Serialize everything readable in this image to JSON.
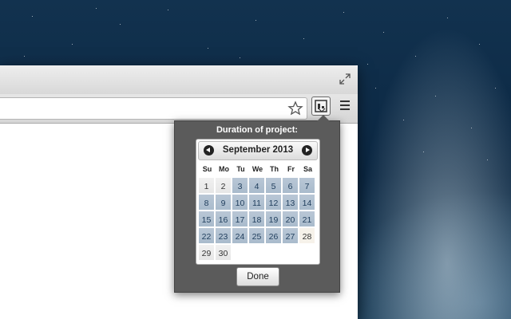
{
  "popup": {
    "title": "Duration of project:",
    "month_label": "September 2013",
    "weekdays": [
      "Su",
      "Mo",
      "Tu",
      "We",
      "Th",
      "Fr",
      "Sa"
    ],
    "weeks": [
      [
        1,
        2,
        3,
        4,
        5,
        6,
        7
      ],
      [
        8,
        9,
        10,
        11,
        12,
        13,
        14
      ],
      [
        15,
        16,
        17,
        18,
        19,
        20,
        21
      ],
      [
        22,
        23,
        24,
        25,
        26,
        27,
        28
      ],
      [
        29,
        30
      ]
    ],
    "highlighted_days": [
      3,
      4,
      5,
      6,
      7,
      8,
      9,
      10,
      11,
      12,
      13,
      14,
      15,
      16,
      17,
      18,
      19,
      20,
      21,
      22,
      23,
      24,
      25,
      26,
      27
    ],
    "done_label": "Done"
  },
  "icons": {
    "fullscreen": "fullscreen-icon",
    "bookmark_star": "star-icon",
    "extension": "extension-icon",
    "menu": "menu-icon",
    "prev_month": "prev-month-icon",
    "next_month": "next-month-icon"
  },
  "colors": {
    "popup_bg": "#5b5b5b",
    "selected_day": "#b9c7d6"
  }
}
